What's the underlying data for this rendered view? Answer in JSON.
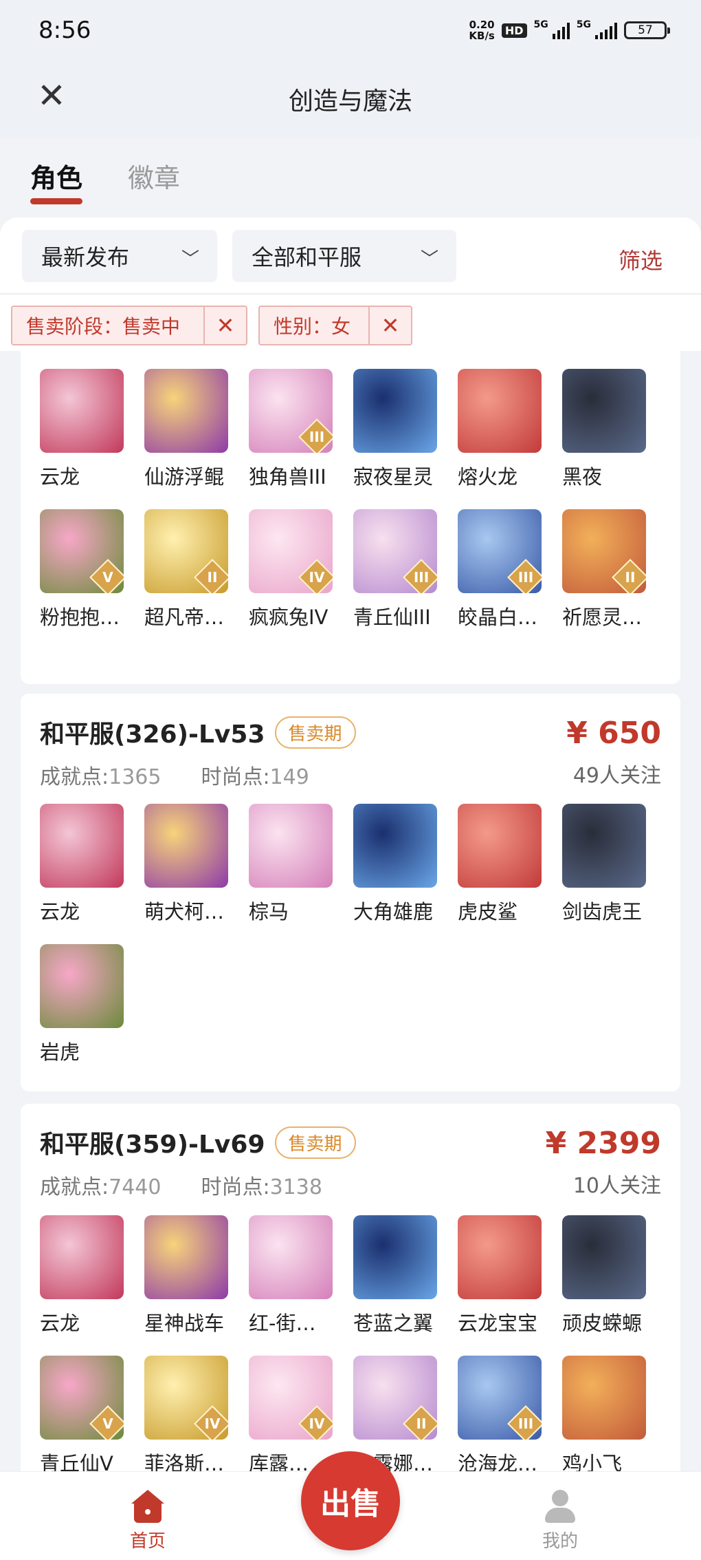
{
  "status": {
    "time": "8:56",
    "speed_top": "0.20",
    "speed_bottom": "KB/s",
    "hd": "HD",
    "net1": "5G",
    "net2": "5G",
    "battery": "57"
  },
  "nav": {
    "title": "创造与魔法",
    "close_icon": "close-icon"
  },
  "tabs": [
    {
      "label": "角色",
      "active": true
    },
    {
      "label": "徽章",
      "active": false
    }
  ],
  "filters": {
    "sort": "最新发布",
    "server": "全部和平服",
    "filter_link": "筛选",
    "chips": [
      {
        "text": "售卖阶段：售卖中"
      },
      {
        "text": "性别：女"
      }
    ]
  },
  "cards": [
    {
      "title": "",
      "badge": "",
      "price": "",
      "stats": "",
      "follow": "",
      "items": [
        {
          "name": "云龙",
          "tier": ""
        },
        {
          "name": "仙游浮鲲",
          "tier": ""
        },
        {
          "name": "独角兽III",
          "tier": "III"
        },
        {
          "name": "寂夜星灵",
          "tier": ""
        },
        {
          "name": "熔火龙",
          "tier": ""
        },
        {
          "name": "黑夜",
          "tier": ""
        },
        {
          "name": "粉抱抱…",
          "tier": "V"
        },
        {
          "name": "超凡帝…",
          "tier": "II"
        },
        {
          "name": "疯疯兔IV",
          "tier": "IV"
        },
        {
          "name": "青丘仙III",
          "tier": "III"
        },
        {
          "name": "皎晶白…",
          "tier": "III"
        },
        {
          "name": "祈愿灵…",
          "tier": "II"
        }
      ]
    },
    {
      "title": "和平服(326)-Lv53",
      "badge": "售卖期",
      "price": "¥ 650",
      "achievement_label": "成就点:",
      "achievement": "1365",
      "fashion_label": "时尚点:",
      "fashion": "149",
      "follow": "49人关注",
      "items": [
        {
          "name": "云龙",
          "tier": ""
        },
        {
          "name": "萌犬柯…",
          "tier": ""
        },
        {
          "name": "棕马",
          "tier": ""
        },
        {
          "name": "大角雄鹿",
          "tier": ""
        },
        {
          "name": "虎皮鲨",
          "tier": ""
        },
        {
          "name": "剑齿虎王",
          "tier": ""
        },
        {
          "name": "岩虎",
          "tier": ""
        }
      ]
    },
    {
      "title": "和平服(359)-Lv69",
      "badge": "售卖期",
      "price": "¥ 2399",
      "achievement_label": "成就点:",
      "achievement": "7440",
      "fashion_label": "时尚点:",
      "fashion": "3138",
      "follow": "10人关注",
      "items": [
        {
          "name": "云龙",
          "tier": ""
        },
        {
          "name": "星神战车",
          "tier": ""
        },
        {
          "name": "红-街…",
          "tier": ""
        },
        {
          "name": "苍蓝之翼",
          "tier": ""
        },
        {
          "name": "云龙宝宝",
          "tier": ""
        },
        {
          "name": "顽皮蝾螈",
          "tier": ""
        },
        {
          "name": "青丘仙V",
          "tier": "V"
        },
        {
          "name": "菲洛斯…",
          "tier": "IV"
        },
        {
          "name": "库露…",
          "tier": "IV"
        },
        {
          "name": "…露娜…",
          "tier": "II"
        },
        {
          "name": "沧海龙…",
          "tier": "III"
        },
        {
          "name": "鸡小飞",
          "tier": ""
        }
      ]
    }
  ],
  "bottom": {
    "home": "首页",
    "sell": "出售",
    "mine": "我的"
  },
  "colors": {
    "accent": "#c0392b",
    "badge": "#d98a2a"
  }
}
